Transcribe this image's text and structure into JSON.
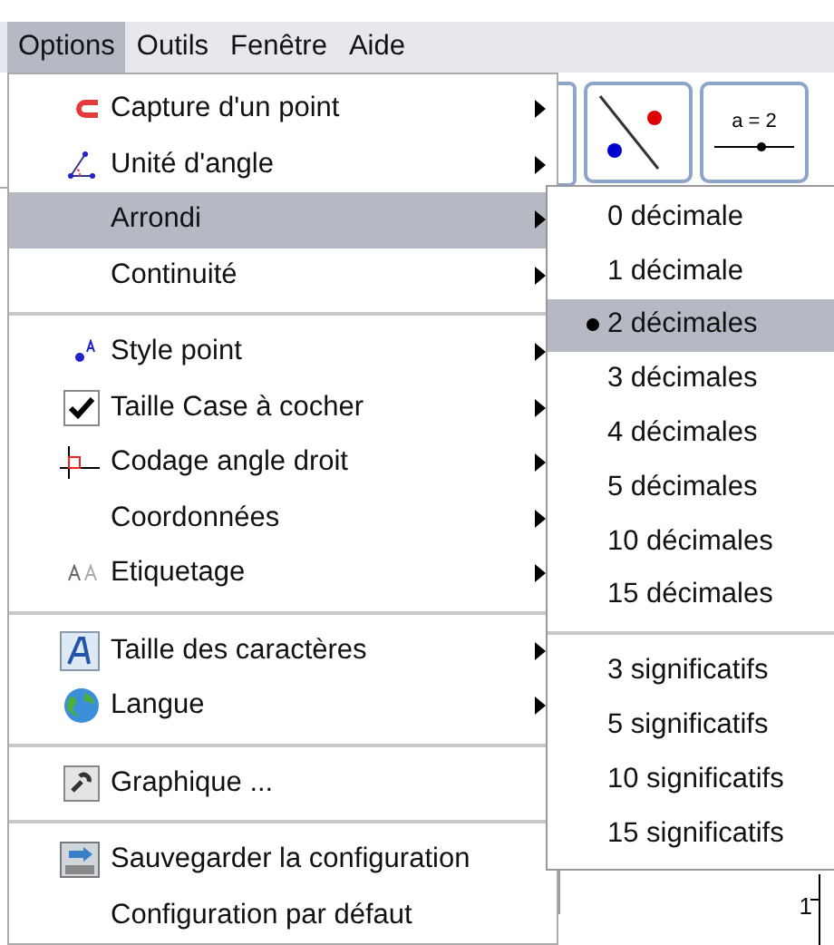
{
  "menubar": [
    {
      "label": "Options",
      "selected": true
    },
    {
      "label": "Outils",
      "selected": false
    },
    {
      "label": "Fenêtre",
      "selected": false
    },
    {
      "label": "Aide",
      "selected": false
    }
  ],
  "toolbar": [
    {
      "kind": "line-points"
    },
    {
      "kind": "slider",
      "label": "a = 2"
    }
  ],
  "graphics": {
    "axis_label": "1"
  },
  "menu": [
    {
      "kind": "item",
      "label": "Capture d'un point",
      "submenu": true,
      "selected": false
    },
    {
      "kind": "item",
      "label": "Unité d'angle",
      "submenu": true,
      "selected": false
    },
    {
      "kind": "item",
      "label": "Arrondi",
      "submenu": true,
      "selected": true
    },
    {
      "kind": "item",
      "label": "Continuité",
      "submenu": true,
      "selected": false
    },
    {
      "kind": "separator"
    },
    {
      "kind": "item",
      "label": "Style point",
      "submenu": true,
      "selected": false
    },
    {
      "kind": "item",
      "label": "Taille Case à cocher",
      "submenu": true,
      "selected": false
    },
    {
      "kind": "item",
      "label": "Codage angle droit",
      "submenu": true,
      "selected": false
    },
    {
      "kind": "item",
      "label": "Coordonnées",
      "submenu": true,
      "selected": false
    },
    {
      "kind": "item",
      "label": "Etiquetage",
      "submenu": true,
      "selected": false
    },
    {
      "kind": "separator"
    },
    {
      "kind": "item",
      "label": "Taille des caractères",
      "submenu": true,
      "selected": false
    },
    {
      "kind": "item",
      "label": "Langue",
      "submenu": true,
      "selected": false
    },
    {
      "kind": "separator"
    },
    {
      "kind": "item",
      "label": "Graphique ...",
      "submenu": false,
      "selected": false
    },
    {
      "kind": "separator"
    },
    {
      "kind": "item",
      "label": "Sauvegarder la configuration",
      "submenu": false,
      "selected": false
    },
    {
      "kind": "item",
      "label": "Configuration par défaut",
      "submenu": false,
      "selected": false
    }
  ],
  "submenu": [
    {
      "kind": "item",
      "label": "0 décimale",
      "checked": false,
      "selected": false
    },
    {
      "kind": "item",
      "label": "1 décimale",
      "checked": false,
      "selected": false
    },
    {
      "kind": "item",
      "label": "2 décimales",
      "checked": true,
      "selected": true
    },
    {
      "kind": "item",
      "label": "3 décimales",
      "checked": false,
      "selected": false
    },
    {
      "kind": "item",
      "label": "4 décimales",
      "checked": false,
      "selected": false
    },
    {
      "kind": "item",
      "label": "5 décimales",
      "checked": false,
      "selected": false
    },
    {
      "kind": "item",
      "label": "10 décimales",
      "checked": false,
      "selected": false
    },
    {
      "kind": "item",
      "label": "15 décimales",
      "checked": false,
      "selected": false
    },
    {
      "kind": "separator"
    },
    {
      "kind": "item",
      "label": "3 significatifs",
      "checked": false,
      "selected": false
    },
    {
      "kind": "item",
      "label": "5 significatifs",
      "checked": false,
      "selected": false
    },
    {
      "kind": "item",
      "label": "10 significatifs",
      "checked": false,
      "selected": false
    },
    {
      "kind": "item",
      "label": "15 significatifs",
      "checked": false,
      "selected": false
    }
  ]
}
